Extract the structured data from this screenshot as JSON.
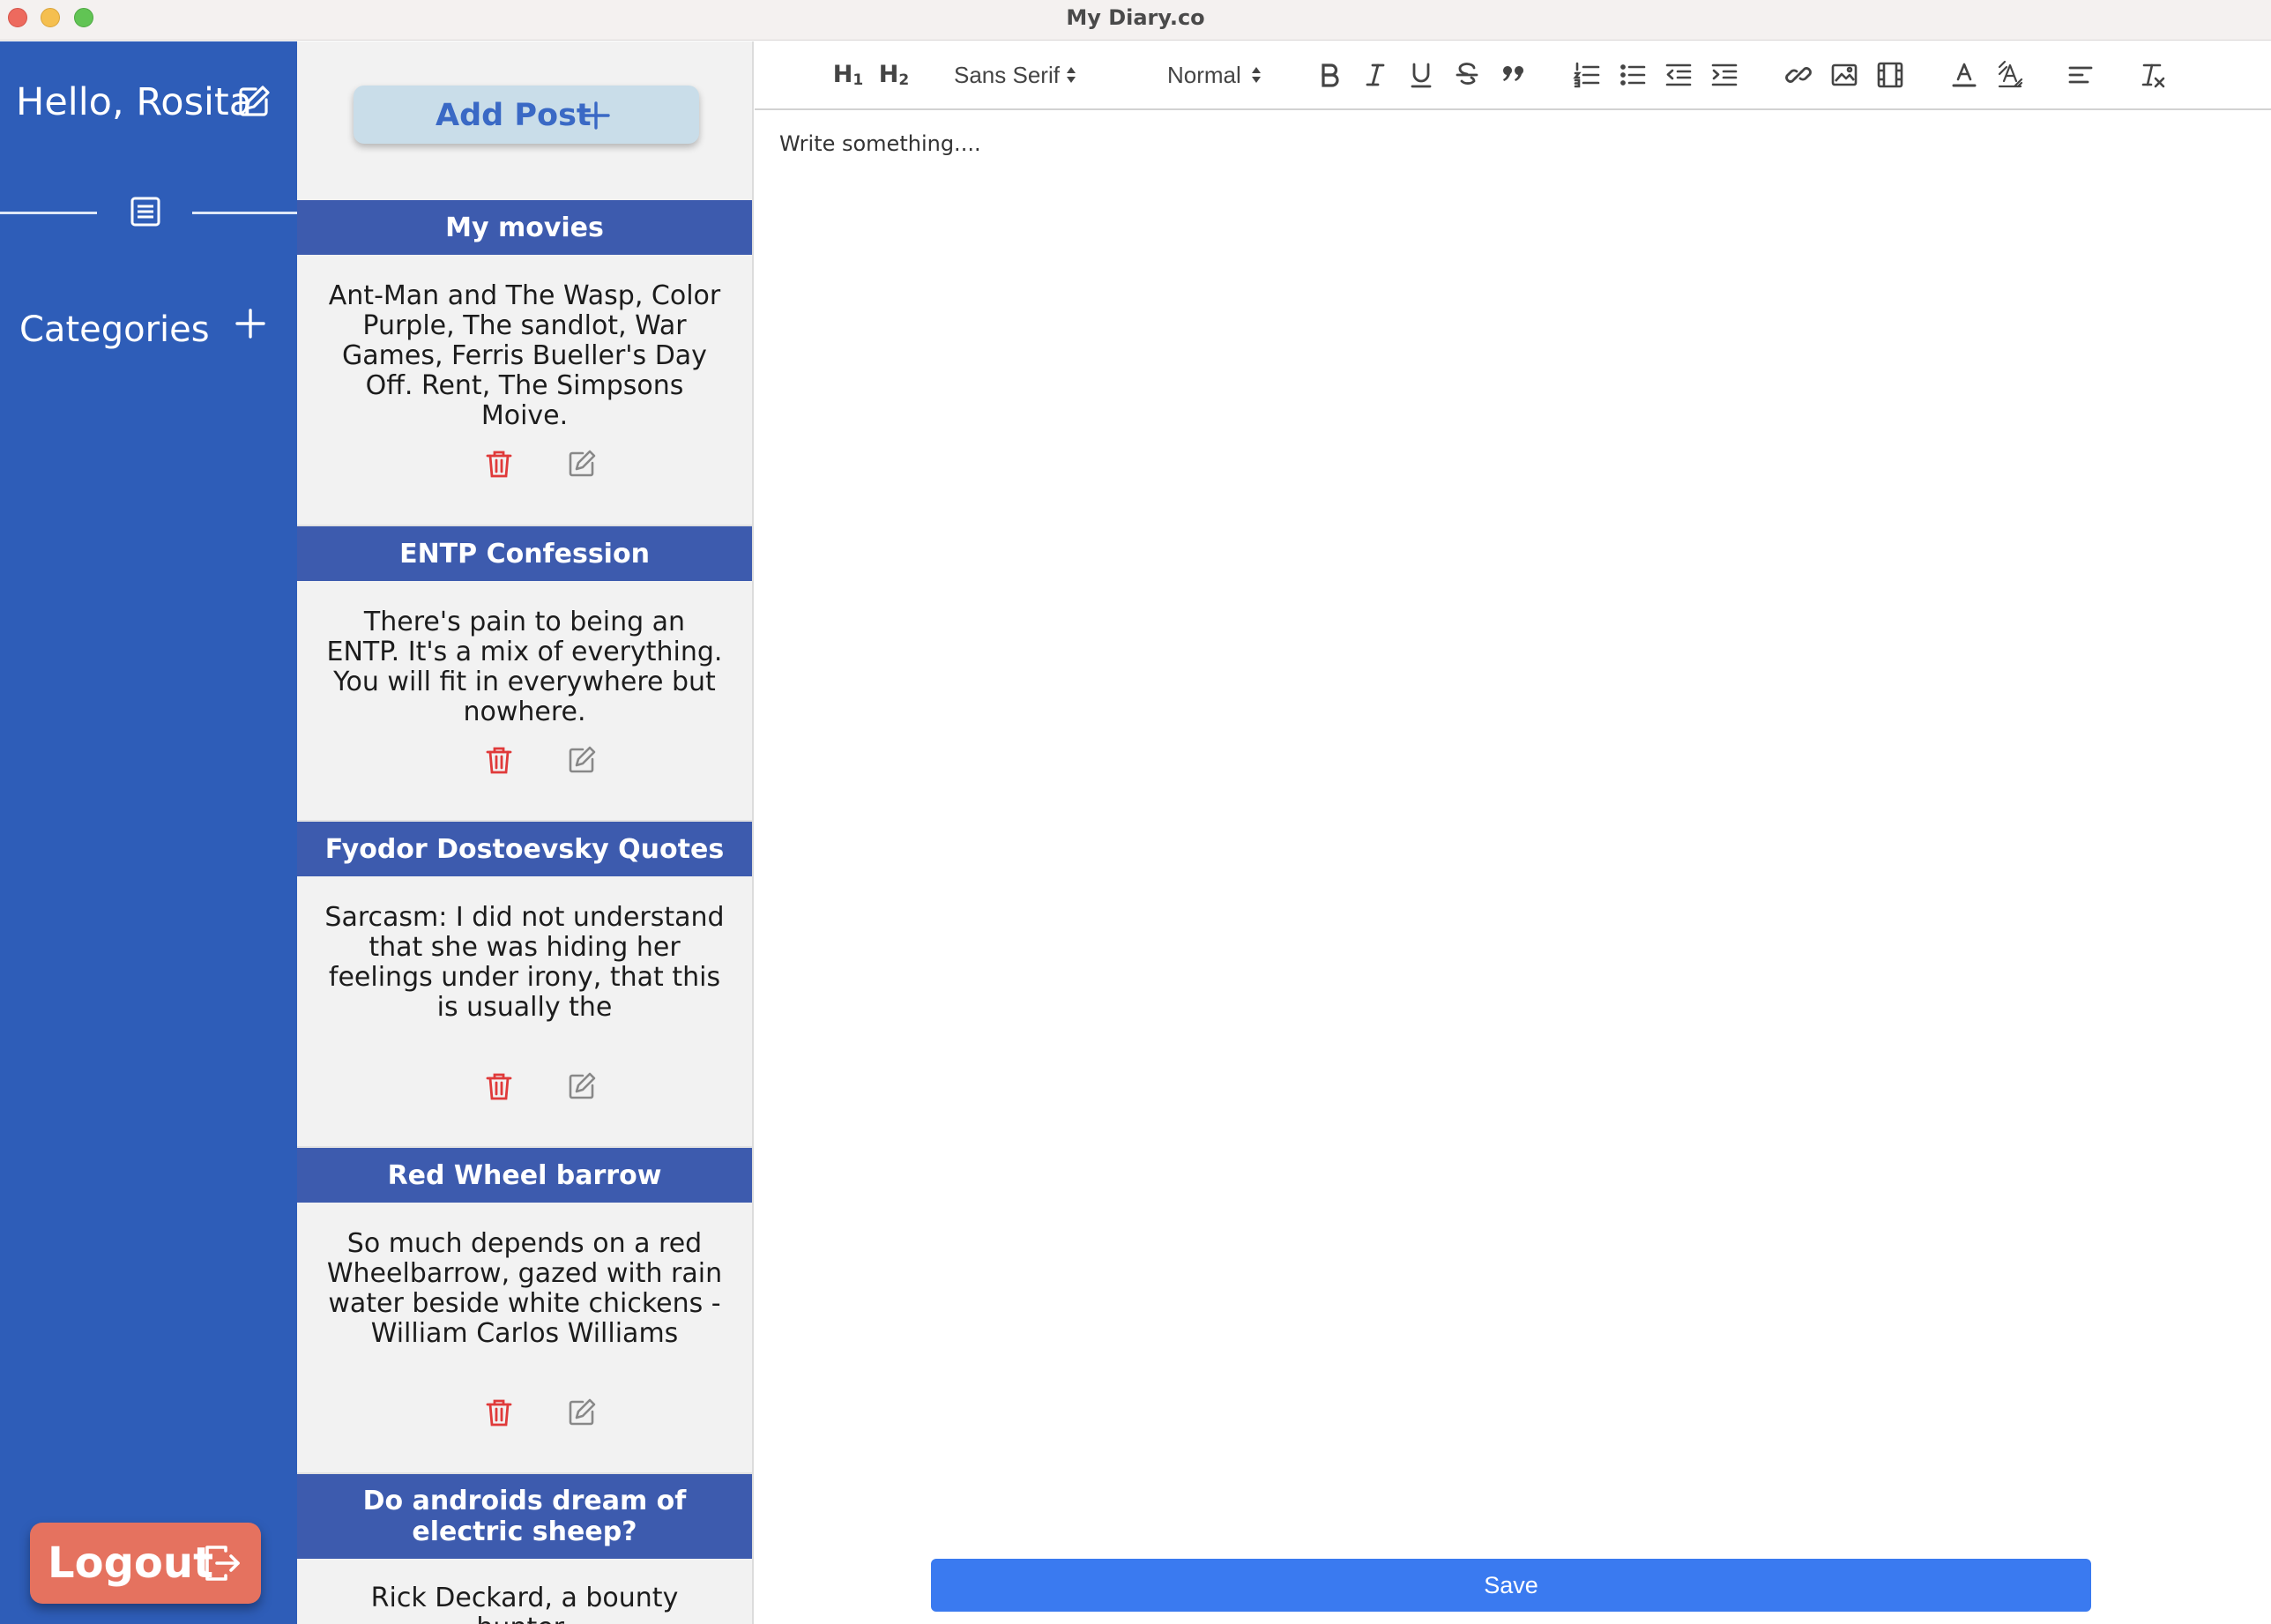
{
  "window": {
    "title": "My Diary.co"
  },
  "sidebar": {
    "greeting": "Hello, Rosita",
    "categories_label": "Categories",
    "logout_label": "Logout",
    "bg_color": "#2e5db8"
  },
  "posts": {
    "add_post_label": "Add Post",
    "items": [
      {
        "title": "My movies",
        "body": "Ant-Man and The Wasp, Color Purple, The sandlot, War Games, Ferris Bueller's Day Off. Rent, The Simpsons Moive."
      },
      {
        "title": "ENTP Confession",
        "body": "There's pain to being an ENTP. It's a mix of everything. You will fit in everywhere but nowhere."
      },
      {
        "title": "Fyodor Dostoevsky Quotes",
        "body": "Sarcasm: I did not understand that she was hiding her feelings under irony, that this is usually the"
      },
      {
        "title": "Red Wheel barrow",
        "body": "So much depends on a red Wheelbarrow, gazed with rain water beside white chickens - William Carlos Williams"
      },
      {
        "title": "Do androids dream of electric sheep?",
        "body": "Rick Deckard, a bounty hunter,"
      }
    ],
    "header_color": "#3d5bae",
    "delete_color": "#e03a3a"
  },
  "editor": {
    "toolbar": {
      "h1_label": "H",
      "h1_sub": "1",
      "h2_label": "H",
      "h2_sub": "2",
      "font_value": "Sans Serif",
      "size_value": "Normal",
      "icons": [
        "bold-icon",
        "italic-icon",
        "underline-icon",
        "strike-icon",
        "blockquote-icon",
        "ordered-list-icon",
        "bullet-list-icon",
        "outdent-icon",
        "indent-icon",
        "link-icon",
        "image-icon",
        "video-icon",
        "text-color-icon",
        "background-color-icon",
        "align-icon",
        "clear-format-icon"
      ]
    },
    "placeholder": "Write something....",
    "save_label": "Save",
    "save_color": "#3a7af0"
  }
}
